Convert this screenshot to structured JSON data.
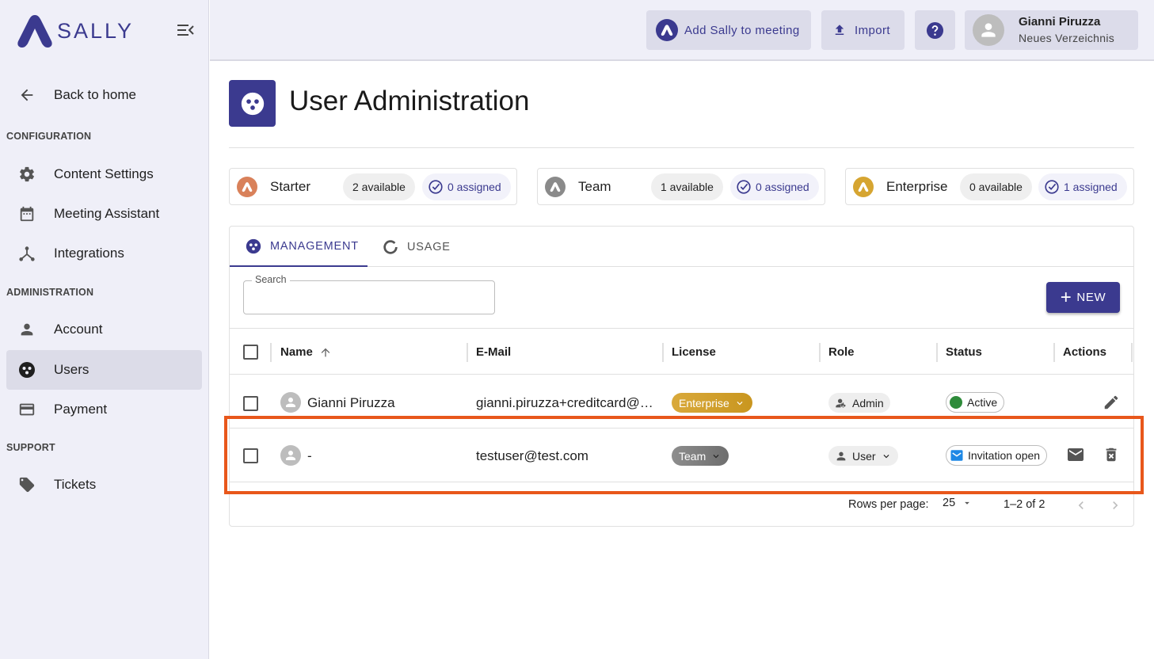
{
  "app": {
    "logo_text": "SALLY"
  },
  "sidebar": {
    "back": "Back to home",
    "sections": {
      "configuration": "CONFIGURATION",
      "administration": "ADMINISTRATION",
      "support": "SUPPORT"
    },
    "items": [
      {
        "label": "Content Settings",
        "icon": "gear-icon"
      },
      {
        "label": "Meeting Assistant",
        "icon": "calendar-icon"
      },
      {
        "label": "Integrations",
        "icon": "integrations-icon"
      },
      {
        "label": "Account",
        "icon": "person-icon"
      },
      {
        "label": "Users",
        "icon": "users-icon",
        "active": true
      },
      {
        "label": "Payment",
        "icon": "credit-card-icon"
      },
      {
        "label": "Tickets",
        "icon": "tag-icon"
      }
    ]
  },
  "topbar": {
    "add_sally": "Add Sally to meeting",
    "import": "Import",
    "help_icon": "help-icon",
    "user_name": "Gianni Piruzza",
    "user_sub": "Neues Verzeichnis"
  },
  "page": {
    "title": "User Administration"
  },
  "licenses": [
    {
      "name": "Starter",
      "available": "2 available",
      "assigned": "0 assigned",
      "color": "#d9815a"
    },
    {
      "name": "Team",
      "available": "1 available",
      "assigned": "0 assigned",
      "color": "#8a8a8a"
    },
    {
      "name": "Enterprise",
      "available": "0 available",
      "assigned": "1 assigned",
      "color": "#d6a531"
    }
  ],
  "tabs": {
    "management": "MANAGEMENT",
    "usage": "USAGE"
  },
  "search": {
    "label": "Search",
    "value": ""
  },
  "new_button": "NEW",
  "table": {
    "headers": {
      "name": "Name",
      "email": "E-Mail",
      "license": "License",
      "role": "Role",
      "status": "Status",
      "actions": "Actions"
    },
    "rows": [
      {
        "name": "Gianni Piruzza",
        "email": "gianni.piruzza+creditcard@…",
        "license": "Enterprise",
        "role": "Admin",
        "status": "Active"
      },
      {
        "name": "-",
        "email": "testuser@test.com",
        "license": "Team",
        "role": "User",
        "status": "Invitation open"
      }
    ]
  },
  "pagination": {
    "rows_per_page_label": "Rows per page:",
    "rows_per_page": "25",
    "range": "1–2 of 2"
  },
  "colors": {
    "accent": "#3b3a8f",
    "highlight": "#e8571b",
    "active": "#2e8b3a"
  }
}
